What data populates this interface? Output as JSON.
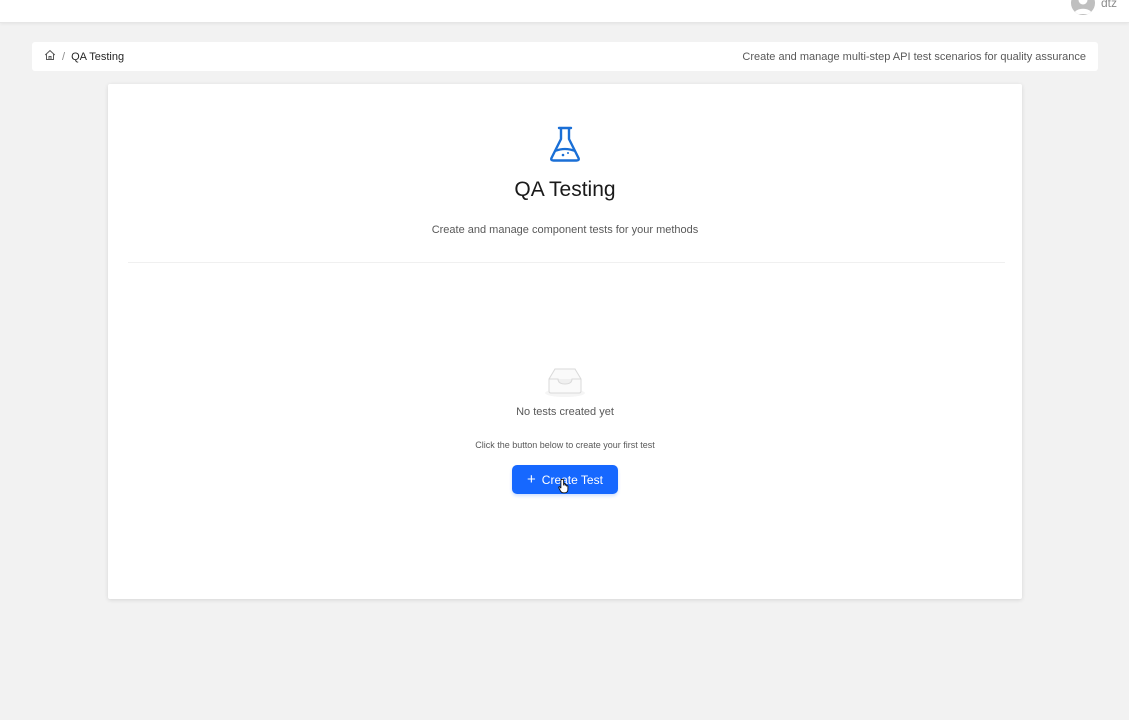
{
  "topbar": {
    "username": "dtz"
  },
  "breadcrumb": {
    "home_icon": "home-icon",
    "separator": "/",
    "current": "QA Testing",
    "description": "Create and manage multi-step API test scenarios for quality assurance"
  },
  "card": {
    "icon": "flask-icon",
    "title": "QA Testing",
    "subtitle": "Create and manage component tests for your methods",
    "empty": {
      "icon": "inbox-icon",
      "title": "No tests created yet",
      "hint": "Click the button below to create your first test"
    },
    "create_button": {
      "icon": "plus-icon",
      "label": "Create Test"
    }
  },
  "colors": {
    "accent": "#1668ff",
    "icon_blue": "#1a6fd6",
    "background": "#f2f2f2"
  }
}
